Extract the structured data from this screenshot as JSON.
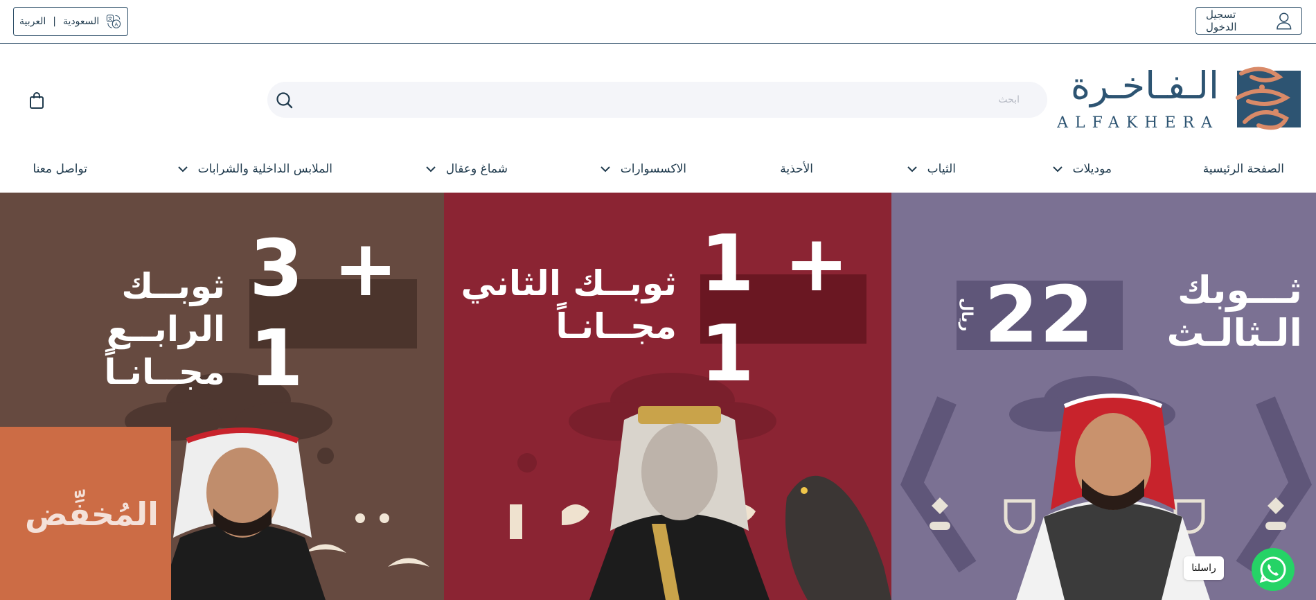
{
  "topbar": {
    "login_label": "تسجيل الدخول",
    "country_label": "السعودية",
    "language_label": "العربية"
  },
  "header": {
    "logo_text_ar": "الـفـاخـرة",
    "logo_text_en": "ALFAKHERA",
    "search_placeholder": "ابحث"
  },
  "nav": {
    "items": [
      {
        "label": "الصفحة الرئيسية"
      },
      {
        "label": "موديلات"
      },
      {
        "label": "الثياب"
      },
      {
        "label": "الأحذية"
      },
      {
        "label": "الاكسسوارات"
      },
      {
        "label": "شماغ وعقال"
      },
      {
        "label": "الملابس الداخلية والشرابات"
      },
      {
        "label": "تواصل معنا"
      }
    ]
  },
  "banners": [
    {
      "headline_line1": "ثـــوبك",
      "headline_line2": "الـثالـث",
      "offer": "22",
      "currency": "ريال",
      "color": "#7b7193"
    },
    {
      "headline_line1": "ثوبــك الثاني",
      "headline_line2": "مجــانـاً",
      "offer": "1 + 1",
      "color": "#8b2433"
    },
    {
      "headline_line1": "ثوبــك الرابــع",
      "headline_line2": "مجــانـاً",
      "offer": "3 + 1",
      "color": "#664a40"
    }
  ],
  "watermark": {
    "text": "المُخفِّض"
  },
  "chat": {
    "label": "راسلنا"
  },
  "colors": {
    "brand": "#2d5472",
    "accent": "#d98a68",
    "whatsapp": "#25d366"
  }
}
